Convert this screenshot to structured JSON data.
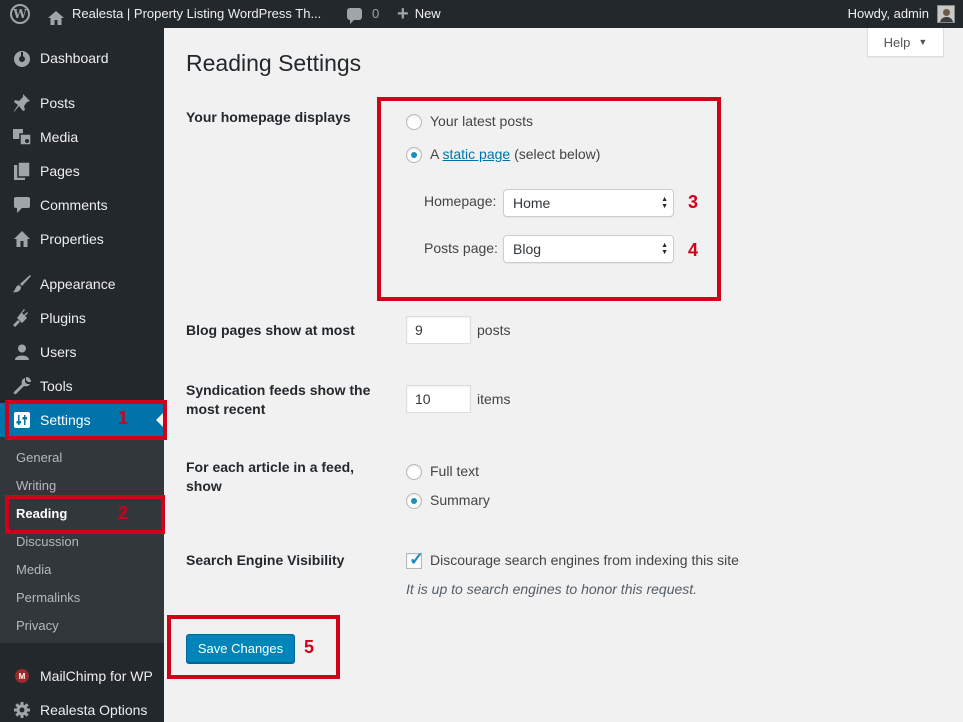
{
  "admin_bar": {
    "site_name": "Realesta | Property Listing WordPress Th...",
    "comments_count": "0",
    "new_label": "New",
    "howdy": "Howdy, admin"
  },
  "sidebar": {
    "items": [
      {
        "label": "Dashboard",
        "icon": "dashboard-icon"
      },
      {
        "label": "Posts",
        "icon": "pushpin-icon"
      },
      {
        "label": "Media",
        "icon": "media-icon"
      },
      {
        "label": "Pages",
        "icon": "pages-icon"
      },
      {
        "label": "Comments",
        "icon": "comment-icon"
      },
      {
        "label": "Properties",
        "icon": "house-icon"
      },
      {
        "label": "Appearance",
        "icon": "paintbrush-icon"
      },
      {
        "label": "Plugins",
        "icon": "plug-icon"
      },
      {
        "label": "Users",
        "icon": "user-icon"
      },
      {
        "label": "Tools",
        "icon": "wrench-icon"
      },
      {
        "label": "Settings",
        "icon": "settings-sliders-icon"
      }
    ],
    "settings_submenu": [
      "General",
      "Writing",
      "Reading",
      "Discussion",
      "Media",
      "Permalinks",
      "Privacy"
    ],
    "bottom_items": [
      {
        "label": "MailChimp for WP",
        "icon": "mailchimp-icon"
      },
      {
        "label": "Realesta Options",
        "icon": "gear-icon"
      }
    ]
  },
  "help": {
    "label": "Help"
  },
  "page_title": "Reading Settings",
  "homepage": {
    "label": "Your homepage displays",
    "option_latest": "Your latest posts",
    "option_static_prefix": "A ",
    "option_static_link": "static page",
    "option_static_suffix": " (select below)",
    "selected": "static",
    "homepage_label": "Homepage:",
    "homepage_value": "Home",
    "posts_page_label": "Posts page:",
    "posts_page_value": "Blog"
  },
  "blog_pages": {
    "label": "Blog pages show at most",
    "value": "9",
    "unit": "posts"
  },
  "syndication": {
    "label": "Syndication feeds show the most recent",
    "value": "10",
    "unit": "items"
  },
  "feed_article": {
    "label": "For each article in a feed, show",
    "option_full": "Full text",
    "option_summary": "Summary",
    "selected": "summary"
  },
  "search_visibility": {
    "label": "Search Engine Visibility",
    "checkbox_label": "Discourage search engines from indexing this site",
    "checked": true,
    "description": "It is up to search engines to honor this request."
  },
  "save_button": "Save Changes",
  "annotations": [
    "1",
    "2",
    "3",
    "4",
    "5"
  ],
  "colors": {
    "annotation": "#d0021b",
    "accent": "#0073aa",
    "sidebar": "#23282d"
  }
}
